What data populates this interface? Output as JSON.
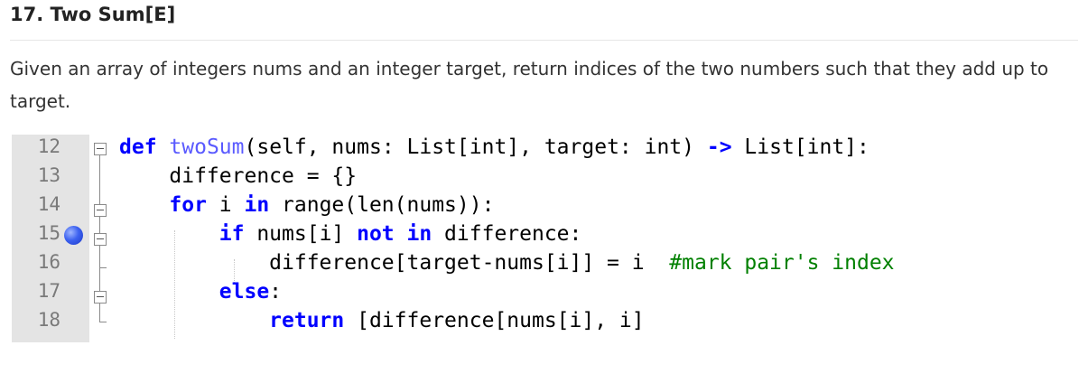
{
  "problem": {
    "title": "17. Two Sum[E]",
    "description": "Given an array of integers nums and an integer target, return indices of the two numbers such that they add up to target."
  },
  "editor": {
    "lines": [
      {
        "number": "12",
        "tokens": [
          {
            "t": "def",
            "c": "kw"
          },
          {
            "t": " "
          },
          {
            "t": "twoSum",
            "c": "fn"
          },
          {
            "t": "(self, nums: List[int], target: int) "
          },
          {
            "t": "->",
            "c": "kw"
          },
          {
            "t": " List[int]:"
          }
        ]
      },
      {
        "number": "13",
        "tokens": [
          {
            "t": "    difference = {}"
          }
        ]
      },
      {
        "number": "14",
        "tokens": [
          {
            "t": "    "
          },
          {
            "t": "for",
            "c": "kw"
          },
          {
            "t": " i "
          },
          {
            "t": "in",
            "c": "kw"
          },
          {
            "t": " range(len(nums)):"
          }
        ]
      },
      {
        "number": "15",
        "tokens": [
          {
            "t": "        "
          },
          {
            "t": "if",
            "c": "kw"
          },
          {
            "t": " nums[i] "
          },
          {
            "t": "not in",
            "c": "kw"
          },
          {
            "t": " difference:"
          }
        ]
      },
      {
        "number": "16",
        "tokens": [
          {
            "t": "            difference[target-nums[i]] = i  "
          },
          {
            "t": "#mark pair's index",
            "c": "cm"
          }
        ]
      },
      {
        "number": "17",
        "tokens": [
          {
            "t": "        "
          },
          {
            "t": "else",
            "c": "kw"
          },
          {
            "t": ":"
          }
        ]
      },
      {
        "number": "18",
        "tokens": [
          {
            "t": "            "
          },
          {
            "t": "return",
            "c": "kw"
          },
          {
            "t": " [difference[nums[i], i]"
          }
        ]
      }
    ],
    "breakpoint_line": "15"
  }
}
